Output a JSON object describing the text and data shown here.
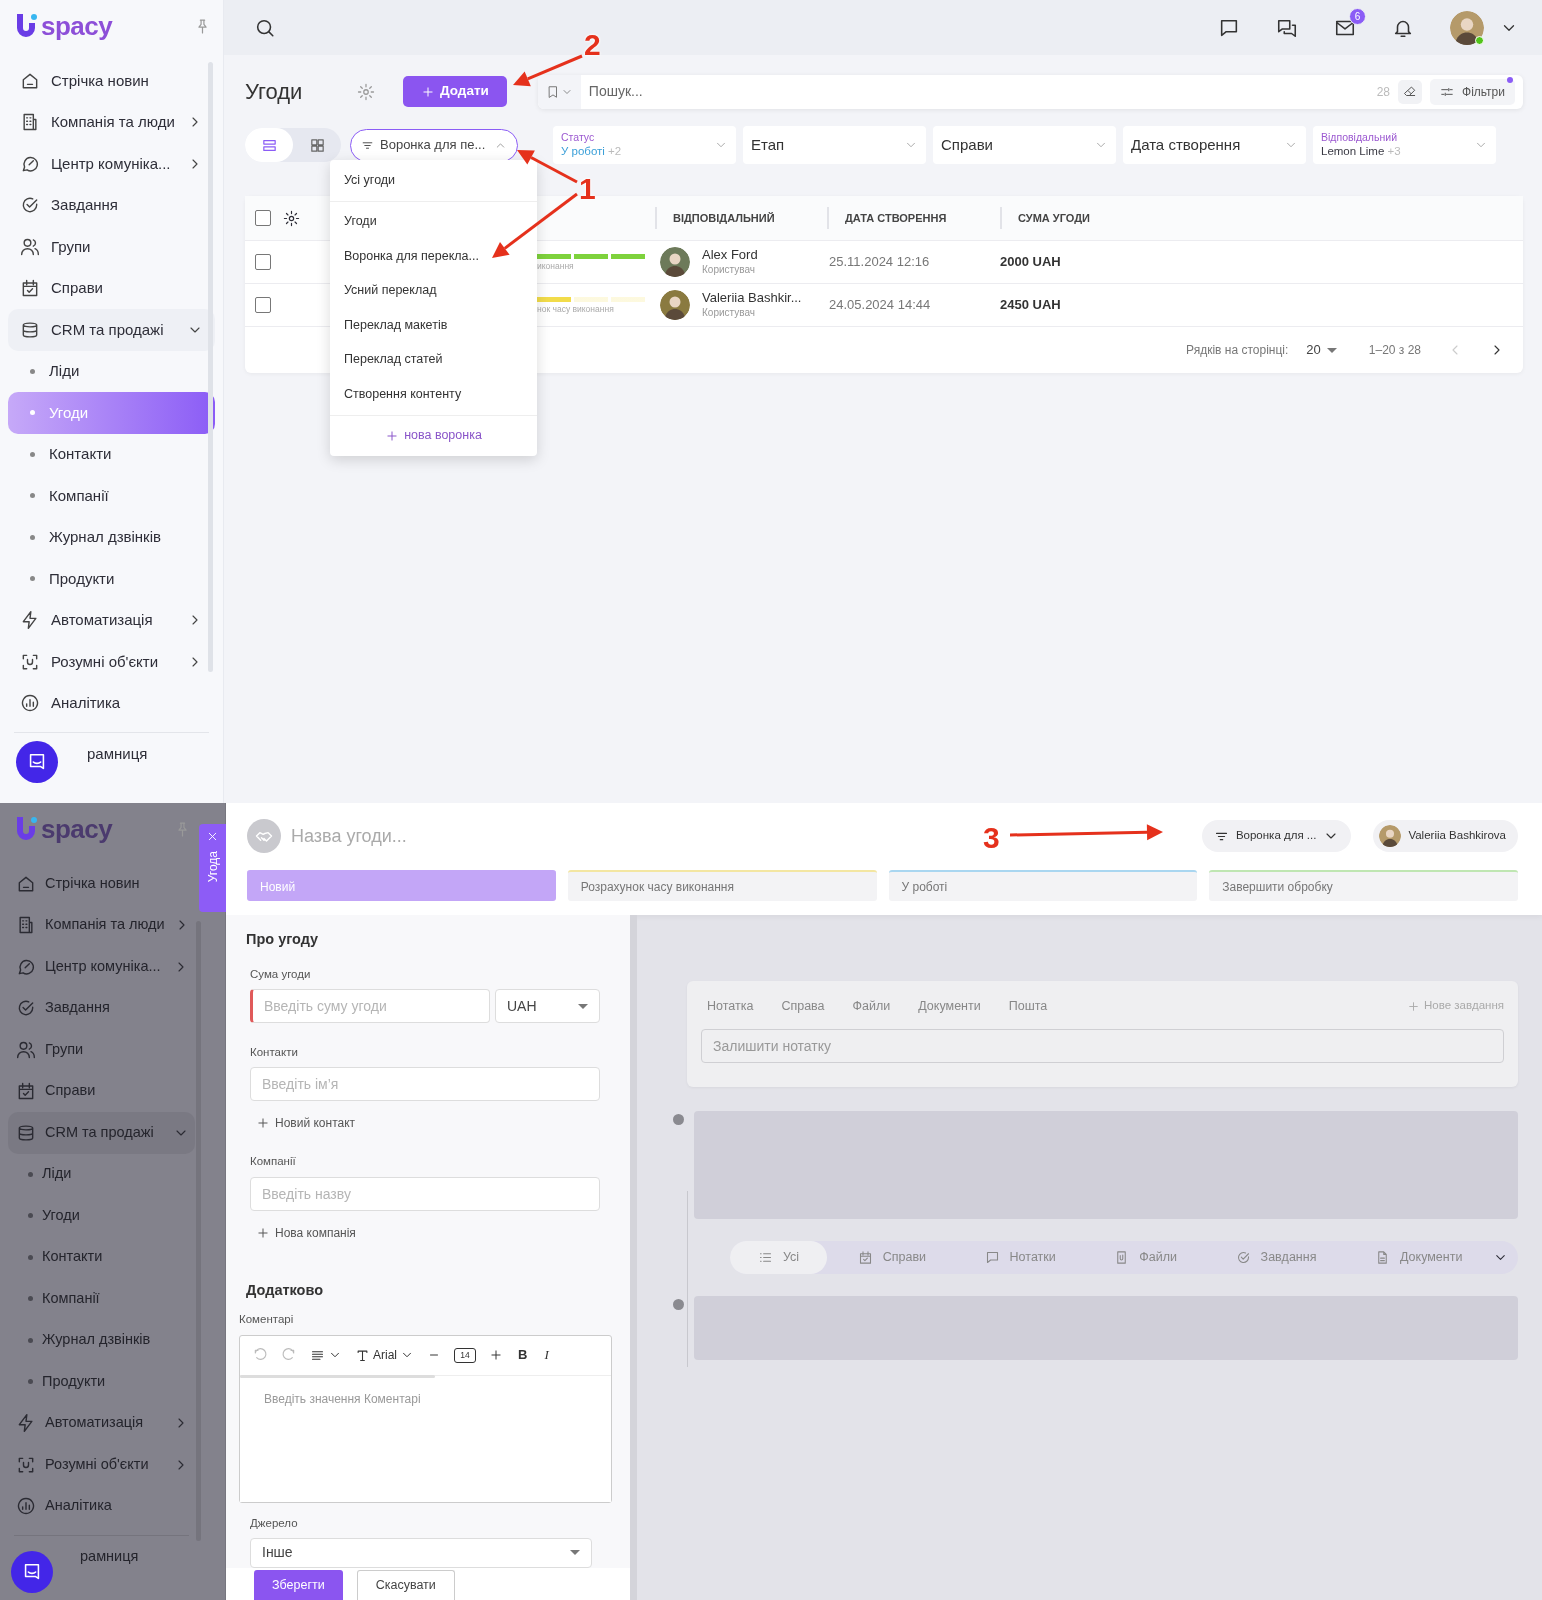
{
  "top_screen": {
    "sidebar": {
      "logo_text": "spacy",
      "items": [
        {
          "label": "Стрічка новин",
          "submenu": false
        },
        {
          "label": "Компанія та люди",
          "submenu": true,
          "expanded": false
        },
        {
          "label": "Центр комуніка...",
          "submenu": true,
          "expanded": false
        },
        {
          "label": "Завдання",
          "submenu": false
        },
        {
          "label": "Групи",
          "submenu": false
        },
        {
          "label": "Справи",
          "submenu": false
        },
        {
          "label": "CRM та продажі",
          "submenu": true,
          "expanded": true,
          "children": [
            {
              "label": "Ліди",
              "selected": false
            },
            {
              "label": "Угоди",
              "selected": true
            },
            {
              "label": "Контакти",
              "selected": false
            },
            {
              "label": "Компанії",
              "selected": false
            },
            {
              "label": "Журнал дзвінків",
              "selected": false
            },
            {
              "label": "Продукти",
              "selected": false
            }
          ]
        },
        {
          "label": "Автоматизація",
          "submenu": true,
          "expanded": false
        },
        {
          "label": "Розумні об'єкти",
          "submenu": true,
          "expanded": false
        },
        {
          "label": "Аналітика",
          "submenu": false
        }
      ],
      "store_label": "рамниця"
    },
    "header": {
      "mail_badge": "6",
      "user_online": true
    },
    "title": "Угоди",
    "add_button": "Додати",
    "search": {
      "placeholder": "Пошук...",
      "count": "28",
      "filters_label": "Фільтри",
      "filters_active": true
    },
    "views": [
      {
        "kind": "list",
        "selected": true
      },
      {
        "kind": "grid",
        "selected": false
      }
    ],
    "funnel_select": {
      "label": "Воронка для пе...",
      "open": true
    },
    "filters": [
      {
        "label": "Статус",
        "value": "У роботі",
        "extra": "+2",
        "color": "#3a9fd8"
      },
      {
        "label": "Етап"
      },
      {
        "label": "Справи"
      },
      {
        "label": "Дата створення"
      },
      {
        "label": "Відповідальний",
        "value": "Lemon Lime",
        "extra": "+3",
        "color": "#3a3a44"
      }
    ],
    "table": {
      "select_all": false,
      "columns": [
        "ВІДПОВІДАЛЬНИЙ",
        "ДАТА СТВОРЕННЯ",
        "СУМА УГОДИ"
      ],
      "rows": [
        {
          "checked": false,
          "stage": {
            "label": "иконання",
            "level": 1,
            "color": "#7ed23c"
          },
          "user": {
            "name": "Alex Ford",
            "role": "Користувач"
          },
          "date": "25.11.2024 12:16",
          "amount": "2000 UAH"
        },
        {
          "checked": false,
          "stage": {
            "label": "нок часу виконання",
            "level": 0.33,
            "color": "#f2dc4a"
          },
          "user": {
            "name": "Valeriia Bashkir...",
            "role": "Користувач"
          },
          "date": "24.05.2024 14:44",
          "amount": "2450 UAH"
        }
      ],
      "pagination": {
        "rows_label": "Рядків на сторінці:",
        "per_page": "20",
        "range": "1–20 з 28",
        "prev_disabled": true
      }
    },
    "funnel_menu": {
      "items": [
        {
          "label": "Усі угоди",
          "selected": false
        },
        {
          "label": "Угоди",
          "selected": false
        },
        {
          "label": "Воронка для перекла...",
          "selected": false
        },
        {
          "label": "Усний переклад",
          "selected": false
        },
        {
          "label": "Переклад макетів",
          "selected": false
        },
        {
          "label": "Переклад статей",
          "selected": false
        },
        {
          "label": "Створення контенту",
          "selected": false
        }
      ],
      "new_label": "нова воронка"
    }
  },
  "bottom_screen": {
    "sidebar": {
      "logo_text": "spacy",
      "items": [
        {
          "label": "Стрічка новин",
          "submenu": false
        },
        {
          "label": "Компанія та люди",
          "submenu": true,
          "expanded": false
        },
        {
          "label": "Центр комуніка...",
          "submenu": true,
          "expanded": false
        },
        {
          "label": "Завдання",
          "submenu": false
        },
        {
          "label": "Групи",
          "submenu": false
        },
        {
          "label": "Справи",
          "submenu": false
        },
        {
          "label": "CRM та продажі",
          "submenu": true,
          "expanded": true,
          "children": [
            {
              "label": "Ліди",
              "selected": false
            },
            {
              "label": "Угоди",
              "selected": false
            },
            {
              "label": "Контакти",
              "selected": false
            },
            {
              "label": "Компанії",
              "selected": false
            },
            {
              "label": "Журнал дзвінків",
              "selected": false
            },
            {
              "label": "Продукти",
              "selected": false
            }
          ]
        },
        {
          "label": "Автоматизація",
          "submenu": true,
          "expanded": false
        },
        {
          "label": "Розумні об'єкти",
          "submenu": true,
          "expanded": false
        },
        {
          "label": "Аналітика",
          "submenu": false
        }
      ],
      "store_label": "рамниця"
    },
    "side_tab": {
      "label": "Угода"
    },
    "deal": {
      "title_placeholder": "Назва угоди...",
      "funnel": "Воронка для ...",
      "user": "Valeriia Bashkirova",
      "stages": [
        {
          "label": "Новий",
          "selected": true,
          "color": "#c3a6f7"
        },
        {
          "label": "Розрахунок часу виконання",
          "selected": false,
          "color": "#f3e6a2"
        },
        {
          "label": "У роботі",
          "selected": false,
          "color": "#a9d6f0"
        },
        {
          "label": "Завершити обробку",
          "selected": false,
          "color": "#bfe6b2"
        }
      ]
    },
    "form": {
      "section_title": "Про угоду",
      "amount": {
        "label": "Сума угоди",
        "placeholder": "Введіть суму угоди",
        "invalid": true,
        "currency": "UAH"
      },
      "contacts": {
        "label": "Контакти",
        "placeholder": "Введіть ім’я",
        "add": "Новий контакт"
      },
      "companies": {
        "label": "Компанії",
        "placeholder": "Введіть назву",
        "add": "Нова компанія"
      },
      "extra_title": "Додатково",
      "comments": {
        "label": "Коментарі",
        "font": "Arial",
        "size": "14",
        "format_buttons": [
          "B",
          "I"
        ],
        "placeholder": "Введіть значення Коментарі"
      },
      "source": {
        "label": "Джерело",
        "value": "Інше"
      },
      "buttons": [
        {
          "label": "Зберегти",
          "kind": "primary"
        },
        {
          "label": "Скасувати",
          "kind": "secondary"
        }
      ]
    },
    "activity": {
      "tabs": [
        {
          "label": "Нотатка",
          "selected": false
        },
        {
          "label": "Справа",
          "selected": false
        },
        {
          "label": "Файли",
          "selected": false
        },
        {
          "label": "Документи",
          "selected": false
        },
        {
          "label": "Пошта",
          "selected": false
        }
      ],
      "new_task": "Нове завдання",
      "note_placeholder": "Залишити нотатку",
      "filters": [
        {
          "label": "Усі",
          "selected": true
        },
        {
          "label": "Справи",
          "selected": false
        },
        {
          "label": "Нотатки",
          "selected": false
        },
        {
          "label": "Файли",
          "selected": false
        },
        {
          "label": "Завдання",
          "selected": false
        },
        {
          "label": "Документи",
          "selected": false
        }
      ]
    }
  },
  "annotations": [
    {
      "label": "2"
    },
    {
      "label": "1"
    },
    {
      "label": "3"
    }
  ]
}
